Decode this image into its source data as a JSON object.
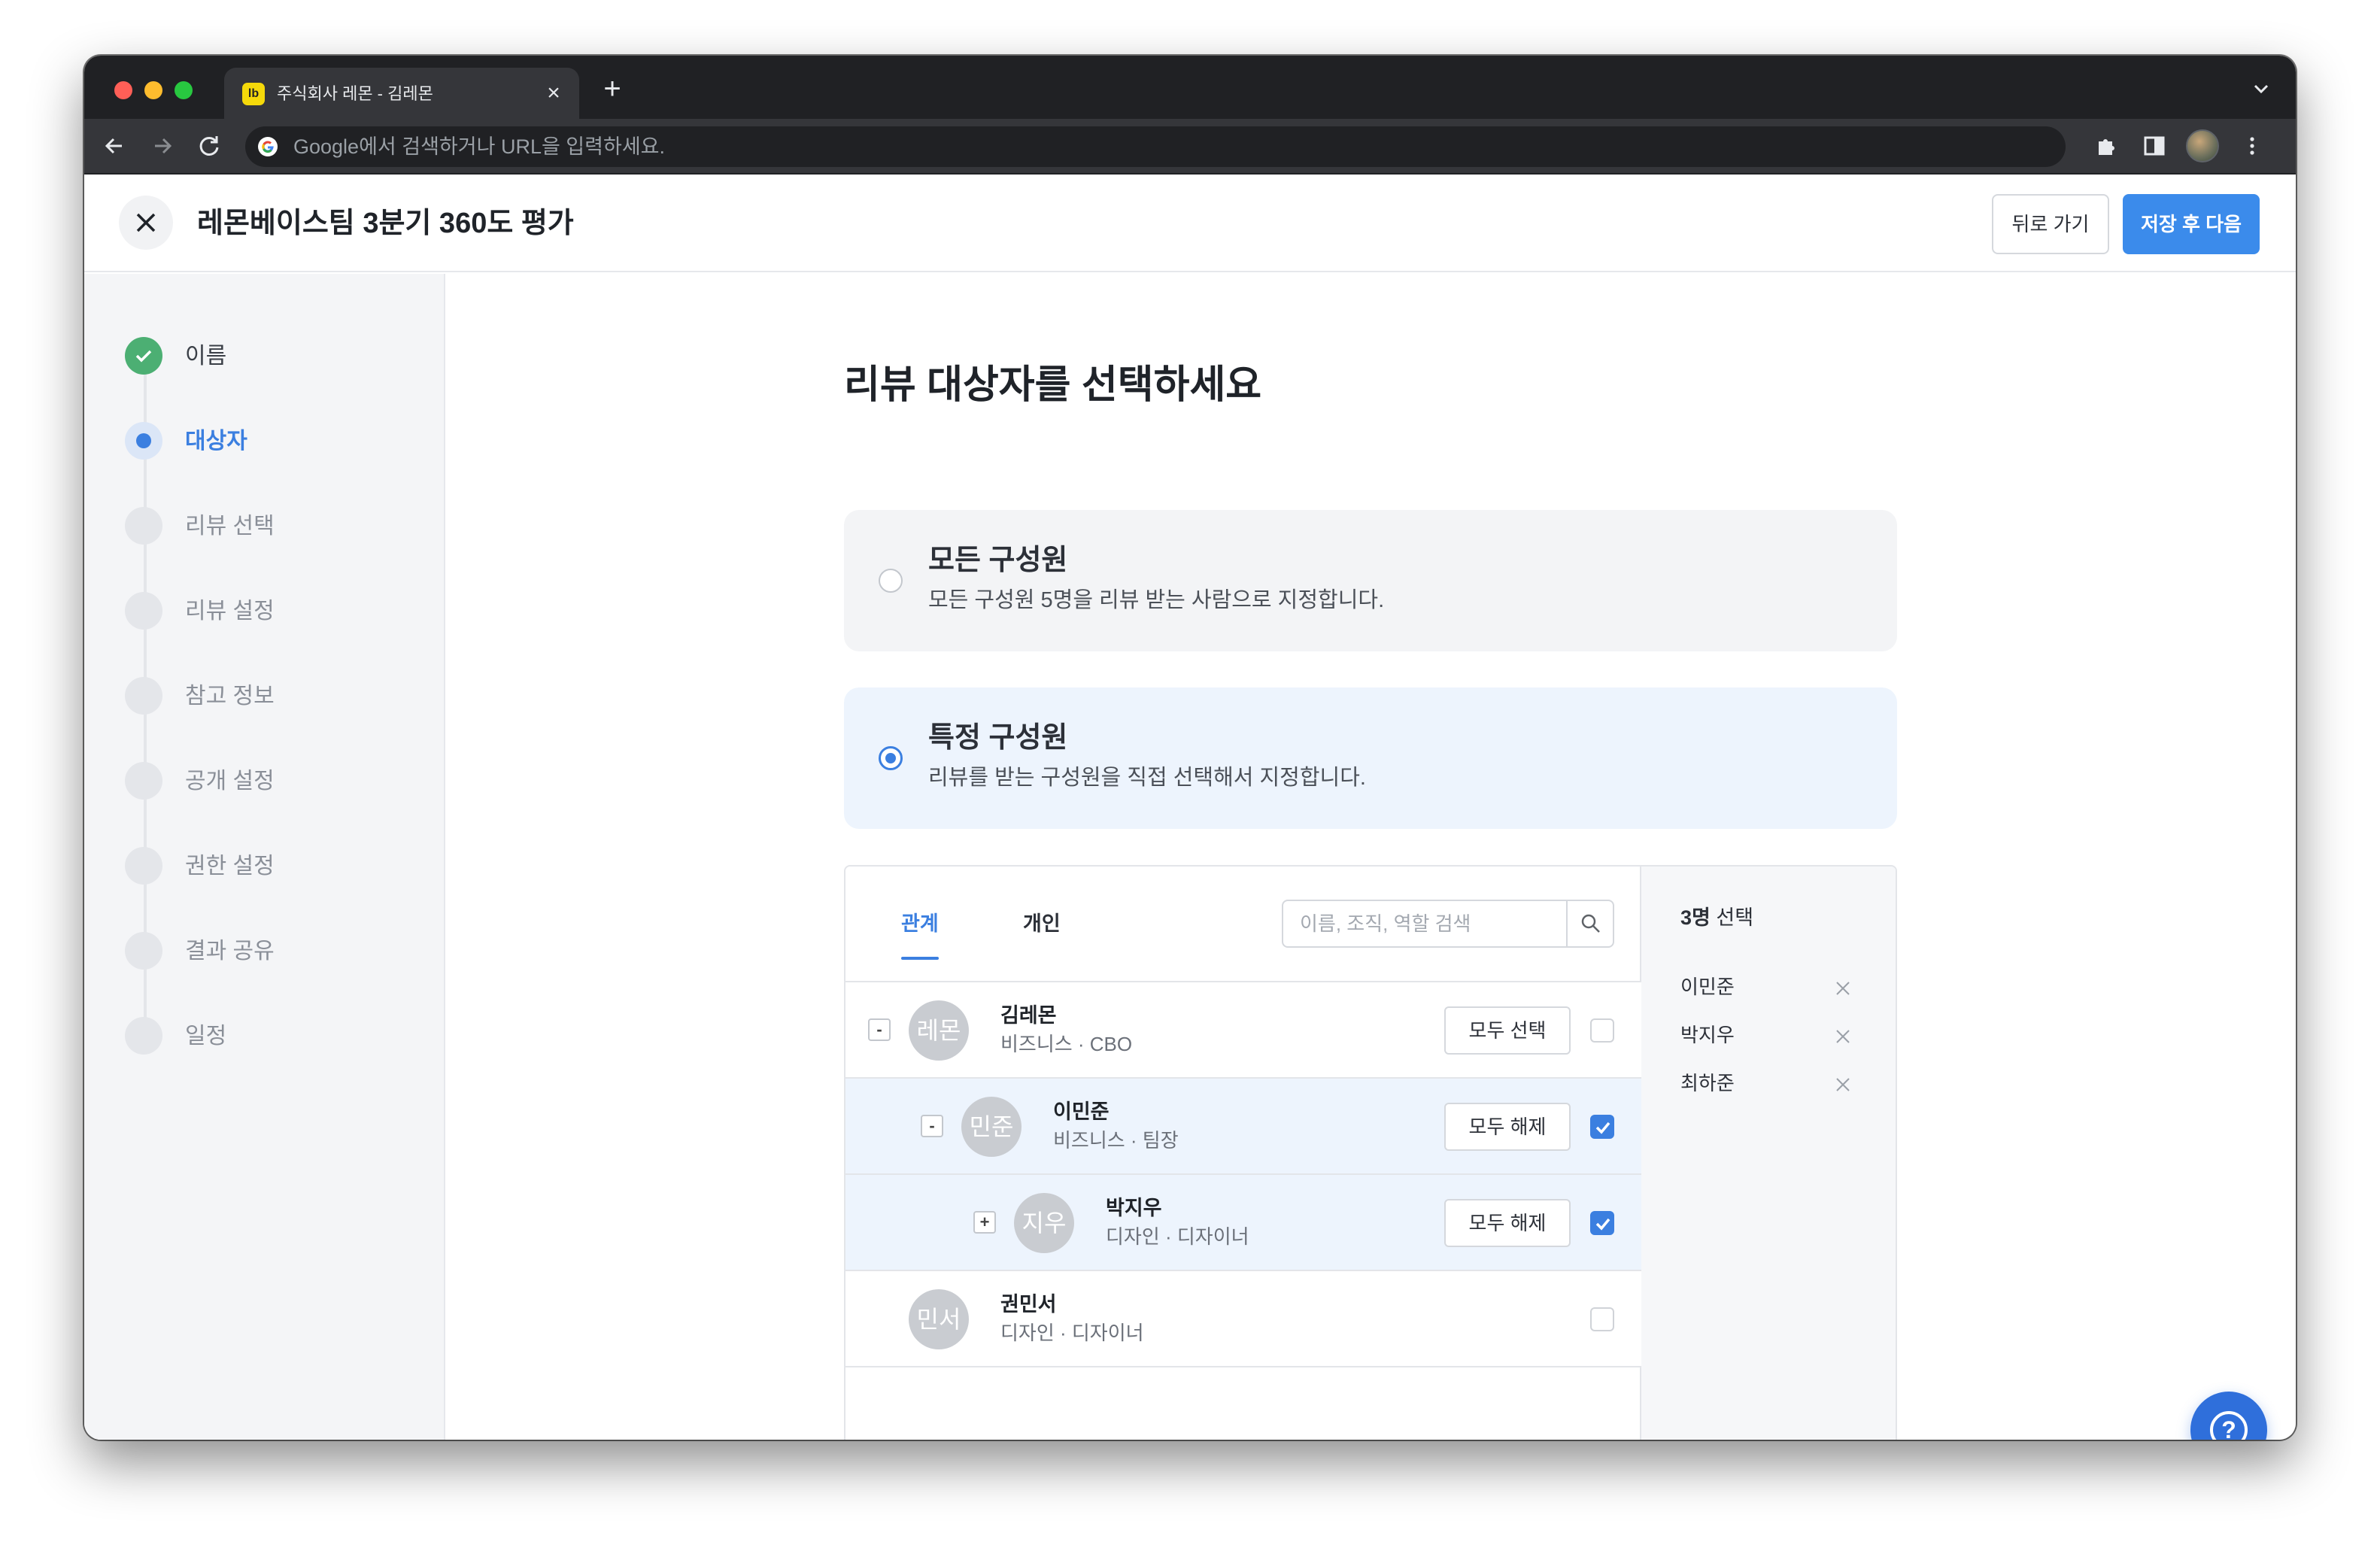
{
  "browser": {
    "tab_title": "주식회사 레몬 - 김레몬",
    "favicon_text": "lb",
    "address_placeholder": "Google에서 검색하거나 URL을 입력하세요."
  },
  "header": {
    "title": "레몬베이스팀 3분기 360도 평가",
    "back_label": "뒤로 가기",
    "next_label": "저장 후 다음"
  },
  "steps": [
    {
      "label": "이름",
      "state": "done"
    },
    {
      "label": "대상자",
      "state": "active"
    },
    {
      "label": "리뷰 선택",
      "state": "todo"
    },
    {
      "label": "리뷰 설정",
      "state": "todo"
    },
    {
      "label": "참고 정보",
      "state": "todo"
    },
    {
      "label": "공개 설정",
      "state": "todo"
    },
    {
      "label": "권한 설정",
      "state": "todo"
    },
    {
      "label": "결과 공유",
      "state": "todo"
    },
    {
      "label": "일정",
      "state": "todo"
    }
  ],
  "main": {
    "heading": "리뷰 대상자를 선택하세요",
    "option_all": {
      "title": "모든 구성원",
      "desc": "모든 구성원 5명을 리뷰 받는 사람으로 지정합니다.",
      "checked": false
    },
    "option_specific": {
      "title": "특정 구성원",
      "desc": "리뷰를 받는 구성원을 직접 선택해서 지정합니다.",
      "checked": true
    }
  },
  "picker": {
    "tab_relation": "관계",
    "tab_individual": "개인",
    "search_placeholder": "이름, 조직, 역할 검색",
    "rows": [
      {
        "expander": "-",
        "avatar": "레몬",
        "name": "김레몬",
        "meta": "비즈니스 · CBO",
        "button": "모두 선택",
        "checked": false,
        "selected": false
      },
      {
        "expander": "-",
        "avatar": "민준",
        "name": "이민준",
        "meta": "비즈니스 · 팀장",
        "button": "모두 해제",
        "checked": true,
        "selected": true
      },
      {
        "expander": "+",
        "avatar": "지우",
        "name": "박지우",
        "meta": "디자인 · 디자이너",
        "button": "모두 해제",
        "checked": true,
        "selected": true
      },
      {
        "expander": "",
        "avatar": "민서",
        "name": "권민서",
        "meta": "디자인 · 디자이너",
        "button": "",
        "checked": false,
        "selected": false
      }
    ]
  },
  "selection": {
    "count": "3명",
    "count_suffix": "선택",
    "items": [
      "이민준",
      "박지우",
      "최하준"
    ]
  },
  "colors": {
    "accent": "#3b7fe0",
    "primary_button": "#3b8beb",
    "done": "#4caf73",
    "selected_row": "#edf4fd"
  }
}
